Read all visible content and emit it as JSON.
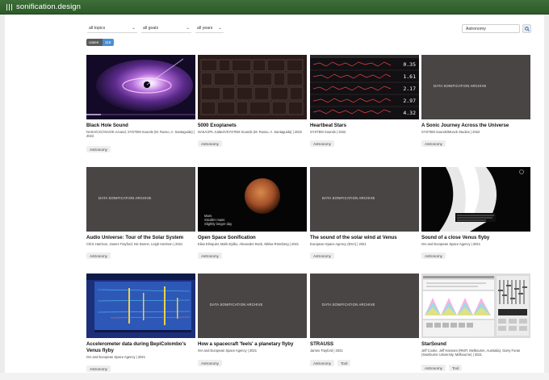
{
  "header": {
    "site_name": "sonification.design"
  },
  "filters": {
    "topics": "all topics",
    "goals": "all goals",
    "years": "all years"
  },
  "search": {
    "value": "Astronomy"
  },
  "count_badge": {
    "label": "cases",
    "count": "115"
  },
  "cards": [
    {
      "title": "Black Hole Sound",
      "credit": "NASA/CXC/SAO/K.Arcand, SYSTEM Sounds (M. Russo, A. Santaguida) | 2022",
      "tags": [
        "Astronomy"
      ]
    },
    {
      "title": "5000 Exoplanets",
      "credit": "NASA/JPL-Caltech/SYSTEM Sounds (M. Russo, A. Santaguida) | 2022",
      "tags": [
        "Astronomy"
      ]
    },
    {
      "title": "Heartbeat Stars",
      "credit": "SYSTEM Sounds | 2022",
      "tags": [
        "Astronomy"
      ],
      "readouts": [
        "0.35",
        "1.61",
        "2.17",
        "2.97",
        "4.32"
      ]
    },
    {
      "title": "A Sonic Journey Across the Universe",
      "credit": "SYSTEM Sounds/Munck Studios | 2022",
      "tags": [
        "Astronomy"
      ],
      "archive": "DATA SONIFICATION ARCHIVE"
    },
    {
      "title": "Audio Universe: Tour of the Solar System",
      "credit": "Chris Harrison, James Trayford, Nic Bonne, Leigh Harrison | 2021",
      "tags": [
        "Astronomy"
      ],
      "archive": "DATA SONIFICATION ARCHIVE"
    },
    {
      "title": "Open Space Sonification",
      "credit": "Elias Elmquist, Malin Ejdbo, Alexander Bock, Niklas Rönnberg | 2021",
      "tags": [
        "Astronomy"
      ],
      "overlay": [
        "Mars",
        "Smaller mass",
        "Slightly longer day"
      ]
    },
    {
      "title": "The sound of the solar wind at Venus",
      "credit": "European Space Agency (ESA) | 2021",
      "tags": [
        "Astronomy"
      ],
      "archive": "DATA SONIFICATION ARCHIVE"
    },
    {
      "title": "Sound of a close Venus flyby",
      "credit": "ISA and European Space Agency | 2021",
      "tags": [
        "Astronomy"
      ]
    },
    {
      "title": "Accelerometer data during BepiColombo's Venus flyby",
      "credit": "ISA and European Space Agency | 2021",
      "tags": [
        "Astronomy"
      ]
    },
    {
      "title": "How a spacecraft 'feels' a planetary flyby",
      "credit": "ISA and European Space Agency | 2021",
      "tags": [
        "Astronomy"
      ],
      "archive": "DATA SONIFICATION ARCHIVE"
    },
    {
      "title": "STRAUSS",
      "credit": "James Trayford | 2021",
      "tags": [
        "Astronomy",
        "Tool"
      ],
      "archive": "DATA SONIFICATION ARCHIVE"
    },
    {
      "title": "StarSound",
      "credit": "Jeff Cooke, Jeff Hannam (RMIT, Melbourne, Australia), Garry Foran (Swinburne University, Melbourne) | 2021",
      "tags": [
        "Astronomy",
        "Tool"
      ]
    }
  ]
}
